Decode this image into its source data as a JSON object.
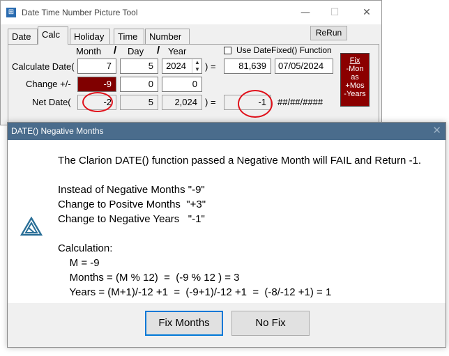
{
  "window": {
    "title": "Date Time Number Picture Tool",
    "minimize": "—",
    "maximize": "☐",
    "close": "✕",
    "icon": "grid-icon"
  },
  "tabs": [
    {
      "label": "Date"
    },
    {
      "label": "Calc"
    },
    {
      "label": "Holiday"
    },
    {
      "label": "Time"
    },
    {
      "label": "Number"
    }
  ],
  "rerun_label": "ReRun",
  "headers": {
    "month": "Month",
    "day": "Day",
    "year": "Year",
    "slash1": "/",
    "slash2": "/"
  },
  "use_datefixed": {
    "label": "Use DateFixed() Function",
    "checked": false
  },
  "rows": {
    "calculate": {
      "label": "Calculate Date(",
      "month": "7",
      "day": "5",
      "year": "2024",
      "eq": ") =",
      "serial": "81,639",
      "date": "07/05/2024"
    },
    "change": {
      "label": "Change +/-",
      "month": "-9",
      "day": "0",
      "year": "0"
    },
    "net": {
      "label": "Net Date(",
      "month": "-2",
      "day": "5",
      "year": "2,024",
      "eq": ") =",
      "serial": "-1",
      "date": "##/##/####"
    }
  },
  "fix_button": {
    "lines": [
      "Fix",
      "-Mon",
      "as",
      "+Mos",
      "-Years"
    ]
  },
  "dialog": {
    "title": "DATE() Negative Months",
    "close": "✕",
    "icon": "clarion-logo-icon",
    "message": [
      "The Clarion DATE() function passed a Negative Month will FAIL and Return -1.",
      "",
      "Instead of Negative Months \"-9\"",
      "Change to Positve Months  \"+3\"",
      "Change to Negative Years   \"-1\"",
      "",
      "Calculation:",
      "    M = -9",
      "    Months = (M % 12)  =  (-9 % 12 ) = 3",
      "    Years = (M+1)/-12 +1  =  (-9+1)/-12 +1  =  (-8/-12 +1) = 1"
    ],
    "buttons": {
      "fix": "Fix Months",
      "nofix": "No Fix"
    }
  },
  "colors": {
    "dialog_title": "#4a6c8c",
    "highlight_field": "#800000",
    "fix_button": "#8b0000",
    "annotation": "#e0101a"
  }
}
